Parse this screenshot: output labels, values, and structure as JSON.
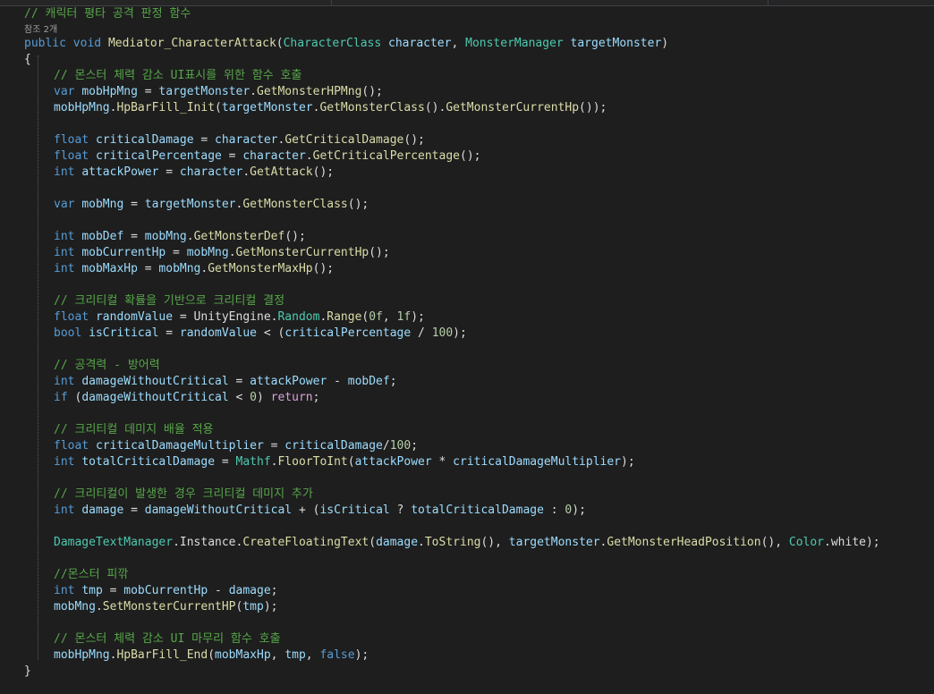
{
  "editor": {
    "colors": {
      "background": "#1e1e1e",
      "keyword": "#569cd6",
      "type": "#4ec9b0",
      "function": "#dcdcaa",
      "variable": "#9cdcfe",
      "number": "#b5cea8",
      "comment": "#57a64a",
      "control": "#d8a0df",
      "plain": "#dcdcdc"
    },
    "header_comment": "// 캐릭터 평타 공격 판정 함수",
    "codelens": "참조 2개",
    "signature": {
      "kw_public": "public",
      "kw_void": "void",
      "method": "Mediator_CharacterAttack",
      "open": "(",
      "type1": "CharacterClass",
      "param1": "character",
      "comma": ", ",
      "type2": "MonsterManager",
      "param2": "targetMonster",
      "close": ")"
    },
    "brace_open": "{",
    "brace_close": "}",
    "lines": {
      "c1": "// 몬스터 체력 감소 UI표시를 위한 함수 호출",
      "l1": {
        "kw": "var",
        "v": "mobHpMng",
        "eq": " = ",
        "o": "targetMonster",
        "dot": ".",
        "fn": "GetMonsterHPMng",
        "end": "();"
      },
      "l2": {
        "o": "mobHpMng",
        "dot": ".",
        "fn": "HpBarFill_Init",
        "p1": "(",
        "o2": "targetMonster",
        "fn2": "GetMonsterClass",
        "mid": "().",
        "fn3": "GetMonsterCurrentHp",
        "end": "());"
      },
      "l3": {
        "kw": "float",
        "v": "criticalDamage",
        "eq": " = ",
        "o": "character",
        "fn": "GetCriticalDamage",
        "end": "();"
      },
      "l4": {
        "kw": "float",
        "v": "criticalPercentage",
        "eq": " = ",
        "o": "character",
        "fn": "GetCriticalPercentage",
        "end": "();"
      },
      "l5": {
        "kw": "int",
        "v": "attackPower",
        "eq": " = ",
        "o": "character",
        "fn": "GetAttack",
        "end": "();"
      },
      "l6": {
        "kw": "var",
        "v": "mobMng",
        "eq": " = ",
        "o": "targetMonster",
        "fn": "GetMonsterClass",
        "end": "();"
      },
      "l7": {
        "kw": "int",
        "v": "mobDef",
        "eq": " = ",
        "o": "mobMng",
        "fn": "GetMonsterDef",
        "end": "();"
      },
      "l8": {
        "kw": "int",
        "v": "mobCurrentHp",
        "eq": " = ",
        "o": "mobMng",
        "fn": "GetMonsterCurrentHp",
        "end": "();"
      },
      "l9": {
        "kw": "int",
        "v": "mobMaxHp",
        "eq": " = ",
        "o": "mobMng",
        "fn": "GetMonsterMaxHp",
        "end": "();"
      },
      "c2": "// 크리티컬 확률을 기반으로 크리티컬 결정",
      "l10": {
        "kw": "float",
        "v": "randomValue",
        "eq": " = ",
        "o": "UnityEngine",
        "t": "Random",
        "fn": "Range",
        "p1": "(",
        "n1": "0f",
        "cm": ", ",
        "n2": "1f",
        "end": ");"
      },
      "l11": {
        "kw": "bool",
        "v": "isCritical",
        "eq": " = ",
        "o": "randomValue",
        "op": " < (",
        "o2": "criticalPercentage",
        "op2": " / ",
        "n": "100",
        "end": ");"
      },
      "c3": "// 공격력 - 방어력",
      "l12": {
        "kw": "int",
        "v": "damageWithoutCritical",
        "eq": " = ",
        "o": "attackPower",
        "op": " - ",
        "o2": "mobDef",
        "end": ";"
      },
      "l13": {
        "kw": "if",
        "p1": " (",
        "o": "damageWithoutCritical",
        "op": " < ",
        "n": "0",
        "p2": ") ",
        "ret": "return",
        "end": ";"
      },
      "c4": "// 크리티컬 데미지 배율 적용",
      "l14": {
        "kw": "float",
        "v": "criticalDamageMultiplier",
        "eq": " = ",
        "o": "criticalDamage",
        "op": "/",
        "n": "100",
        "end": ";"
      },
      "l15": {
        "kw": "int",
        "v": "totalCriticalDamage",
        "eq": " = ",
        "t": "Mathf",
        "fn": "FloorToInt",
        "p1": "(",
        "o": "attackPower",
        "op": " * ",
        "o2": "criticalDamageMultiplier",
        "end": ");"
      },
      "c5": "// 크리티컬이 발생한 경우 크리티컬 데미지 추가",
      "l16": {
        "kw": "int",
        "v": "damage",
        "eq": " = ",
        "o": "damageWithoutCritical",
        "op": " + (",
        "o2": "isCritical",
        "op2": " ? ",
        "o3": "totalCriticalDamage",
        "op3": " : ",
        "n": "0",
        "end": ");"
      },
      "l17": {
        "t": "DamageTextManager",
        "o": "Instance",
        "fn": "CreateFloatingText",
        "p1": "(",
        "o2": "damage",
        "fn2": "ToString",
        "mid": "(), ",
        "o3": "targetMonster",
        "fn3": "GetMonsterHeadPosition",
        "mid2": "(), ",
        "t2": "Color",
        "o4": "white",
        "end": ");"
      },
      "c6": "//몬스터 피깎",
      "l18": {
        "kw": "int",
        "v": "tmp",
        "eq": " = ",
        "o": "mobCurrentHp",
        "op": " - ",
        "o2": "damage",
        "end": ";"
      },
      "l19": {
        "o": "mobMng",
        "fn": "SetMonsterCurrentHP",
        "p1": "(",
        "o2": "tmp",
        "end": ");"
      },
      "c7": "// 몬스터 체력 감소 UI 마무리 함수 호출",
      "l20": {
        "o": "mobHpMng",
        "fn": "HpBarFill_End",
        "p1": "(",
        "o2": "mobMaxHp",
        "cm": ", ",
        "o3": "tmp",
        "cm2": ", ",
        "kw": "false",
        "end": ");"
      }
    }
  }
}
